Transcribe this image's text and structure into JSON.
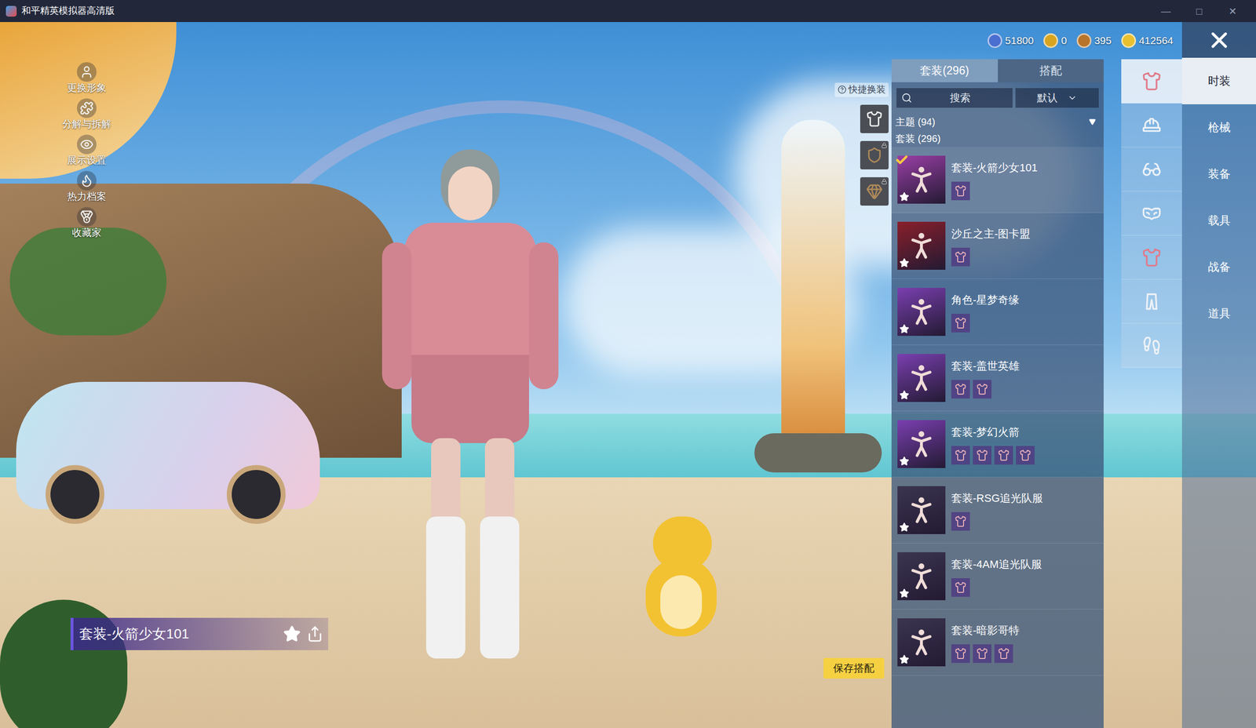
{
  "window": {
    "title": "和平精英模拟器高清版",
    "controls": [
      "—",
      "□",
      "✕"
    ]
  },
  "currencies": [
    {
      "value": "51800",
      "color": "#4a6fd0"
    },
    {
      "value": "0",
      "color": "#d9a520"
    },
    {
      "value": "395",
      "color": "#b8742a"
    },
    {
      "value": "412564",
      "color": "#e8c030"
    }
  ],
  "side_menu": [
    {
      "label": "更换形象"
    },
    {
      "label": "分解与拆解"
    },
    {
      "label": "展示设置"
    },
    {
      "label": "热力档案"
    },
    {
      "label": "收藏家"
    }
  ],
  "quick_switch": {
    "label": "快捷换装",
    "slots": [
      {
        "locked": false
      },
      {
        "locked": true
      },
      {
        "locked": true
      }
    ]
  },
  "outfit_panel": {
    "tabs": [
      {
        "label": "套装(296)",
        "selected": true
      },
      {
        "label": "搭配",
        "selected": false
      }
    ],
    "search": {
      "placeholder": "搜索"
    },
    "sort": {
      "value": "默认"
    },
    "theme_group": {
      "label": "主题 (94)",
      "expanded": false
    },
    "suit_group": {
      "label": "套装 (296)"
    },
    "items": [
      {
        "name": "套装-火箭少女101",
        "selected": true,
        "favorite": true,
        "parts": 1,
        "color": "#9a3fa6"
      },
      {
        "name": "沙丘之主-图卡盟",
        "selected": false,
        "favorite": true,
        "parts": 1,
        "color": "#8a1f2a"
      },
      {
        "name": "角色-星梦奇缘",
        "selected": false,
        "favorite": true,
        "parts": 1,
        "color": "#7a3fb0"
      },
      {
        "name": "套装-盖世英雄",
        "selected": false,
        "favorite": true,
        "parts": 2,
        "color": "#7a3fb0"
      },
      {
        "name": "套装-梦幻火箭",
        "selected": false,
        "favorite": true,
        "parts": 4,
        "color": "#7a3fb0"
      },
      {
        "name": "套装-RSG追光队服",
        "selected": false,
        "favorite": true,
        "parts": 1,
        "color": "#3b3550"
      },
      {
        "name": "套装-4AM追光队服",
        "selected": false,
        "favorite": true,
        "parts": 1,
        "color": "#3b3550"
      },
      {
        "name": "套装-暗影哥特",
        "selected": false,
        "favorite": true,
        "parts": 3,
        "color": "#3b3550"
      }
    ]
  },
  "slot_icons": [
    {
      "kind": "top",
      "selected": true
    },
    {
      "kind": "hat",
      "selected": false
    },
    {
      "kind": "glasses",
      "selected": false
    },
    {
      "kind": "mask",
      "selected": false
    },
    {
      "kind": "top",
      "selected": false
    },
    {
      "kind": "pants",
      "selected": false
    },
    {
      "kind": "shoes",
      "selected": false
    }
  ],
  "categories": [
    {
      "label": "时装",
      "selected": true
    },
    {
      "label": "枪械",
      "selected": false
    },
    {
      "label": "装备",
      "selected": false
    },
    {
      "label": "载具",
      "selected": false
    },
    {
      "label": "战备",
      "selected": false
    },
    {
      "label": "道具",
      "selected": false
    }
  ],
  "current_outfit": {
    "name": "套装-火箭少女101",
    "favorite": false
  },
  "save_button": "保存搭配"
}
